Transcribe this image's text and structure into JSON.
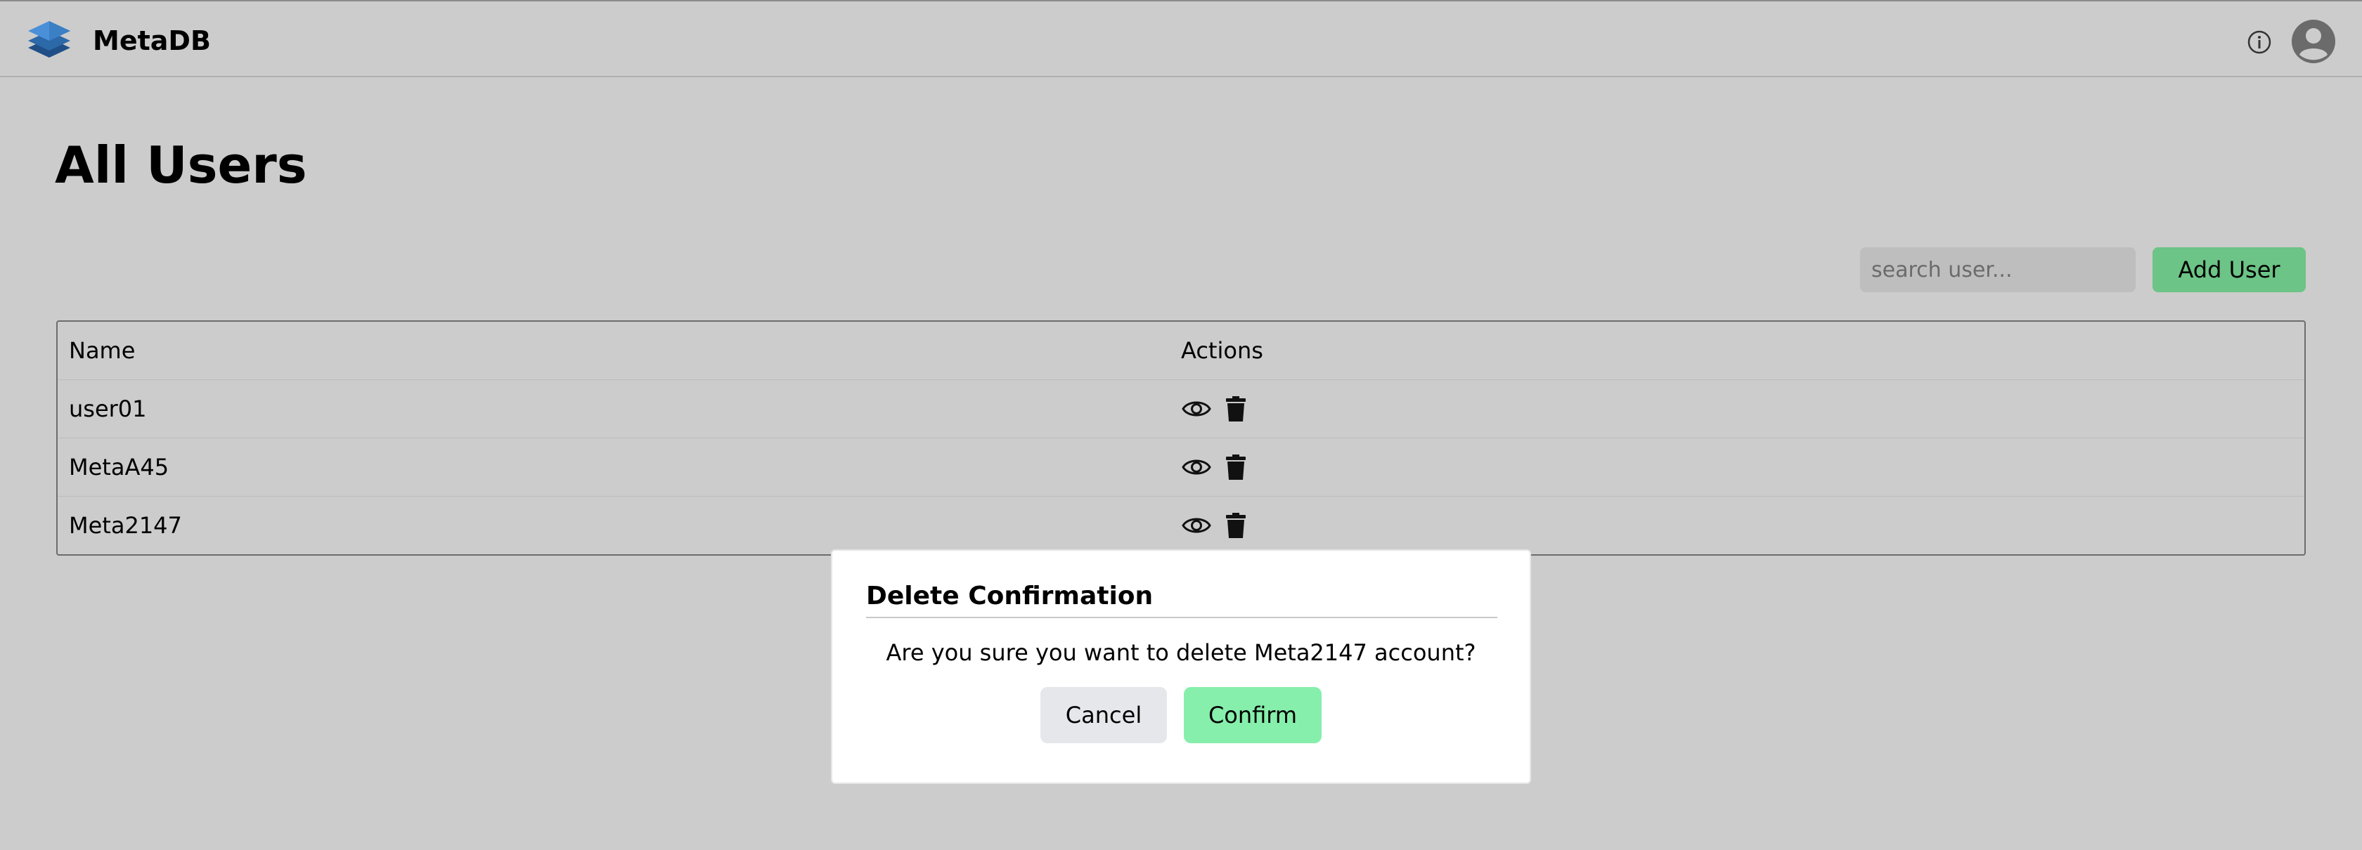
{
  "app": {
    "brand": "MetaDB",
    "logo_icon": "layers-icon",
    "info_icon": "info-icon",
    "avatar_icon": "user-circle-icon"
  },
  "page": {
    "title": "All Users"
  },
  "toolbar": {
    "search_placeholder": "search user...",
    "search_value": "",
    "add_user_label": "Add User"
  },
  "table": {
    "columns": [
      "Name",
      "Actions"
    ],
    "rows": [
      {
        "name": "user01"
      },
      {
        "name": "MetaA45"
      },
      {
        "name": "Meta2147"
      }
    ],
    "action_icons": [
      "eye-icon",
      "trash-icon"
    ]
  },
  "modal": {
    "title": "Delete Confirmation",
    "message": "Are you sure you want to delete Meta2147 account?",
    "cancel_label": "Cancel",
    "confirm_label": "Confirm"
  },
  "colors": {
    "page_background": "#cccccc",
    "accent_green": "#6cc486",
    "confirm_green": "#86efac",
    "cancel_gray": "#e5e7eb",
    "logo_blue": "#3b7fc4"
  }
}
